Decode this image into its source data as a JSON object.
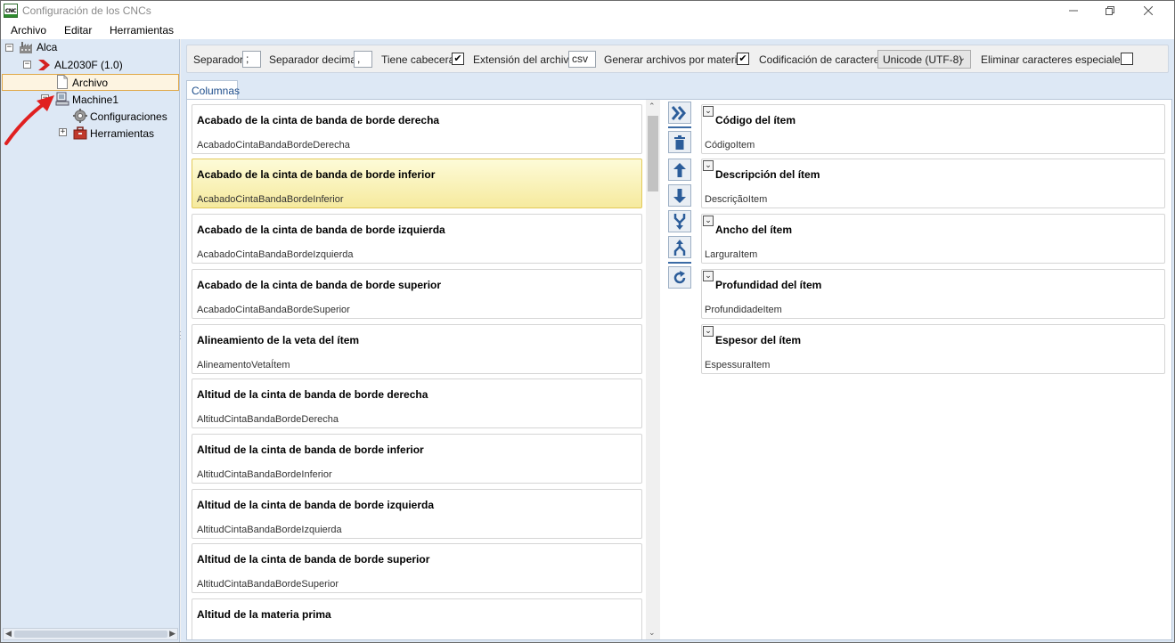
{
  "window": {
    "title": "Configuración de los CNCs",
    "app_icon_text": "CNC"
  },
  "menu": [
    "Archivo",
    "Editar",
    "Herramientas"
  ],
  "tree": {
    "root": {
      "label": "Alca",
      "icon": "factory-icon"
    },
    "machine_group": {
      "label": "AL2030F (1.0)",
      "icon": "chevron-right-red-icon"
    },
    "selected": {
      "label": "Archivo",
      "icon": "document-icon"
    },
    "machine": {
      "label": "Machine1",
      "icon": "computer-icon"
    },
    "config": {
      "label": "Configuraciones",
      "icon": "gear-icon"
    },
    "tools": {
      "label": "Herramientas",
      "icon": "toolbox-icon"
    }
  },
  "options": {
    "separador_label": "Separador",
    "separador_value": ";",
    "decimal_label": "Separador decimal",
    "decimal_value": ",",
    "cabecera_label": "Tiene cabecera",
    "cabecera_checked": true,
    "extension_label": "Extensión del archivo",
    "extension_value": "csv",
    "por_material_label": "Generar archivos por material",
    "por_material_checked": true,
    "codificacion_label": "Codificación de caracteres",
    "codificacion_value": "Unicode (UTF-8)",
    "eliminar_label": "Eliminar caracteres especiales",
    "eliminar_checked": false
  },
  "tabs": [
    "Columnas"
  ],
  "available_columns": [
    {
      "title": "Acabado de la cinta de banda de borde derecha",
      "key": "AcabadoCintaBandaBordeDerecha"
    },
    {
      "title": "Acabado de la cinta de banda de borde inferior",
      "key": "AcabadoCintaBandaBordeInferior"
    },
    {
      "title": "Acabado de la cinta de banda de borde izquierda",
      "key": "AcabadoCintaBandaBordeIzquierda"
    },
    {
      "title": "Acabado de la cinta de banda de borde superior",
      "key": "AcabadoCintaBandaBordeSuperior"
    },
    {
      "title": "Alineamiento de la veta del ítem",
      "key": "AlineamentoVetaÍtem"
    },
    {
      "title": "Altitud de la cinta de banda de borde derecha",
      "key": "AltitudCintaBandaBordeDerecha"
    },
    {
      "title": "Altitud de la cinta de banda de borde inferior",
      "key": "AltitudCintaBandaBordeInferior"
    },
    {
      "title": "Altitud de la cinta de banda de borde izquierda",
      "key": "AltitudCintaBandaBordeIzquierda"
    },
    {
      "title": "Altitud de la cinta de banda de borde superior",
      "key": "AltitudCintaBandaBordeSuperior"
    },
    {
      "title": "Altitud de la materia prima",
      "key": ""
    }
  ],
  "selected_available_index": 1,
  "selected_columns": [
    {
      "title": "Código del ítem",
      "key": "CódigoItem"
    },
    {
      "title": "Descripción del ítem",
      "key": "DescriçãoItem"
    },
    {
      "title": "Ancho del ítem",
      "key": "LarguraItem"
    },
    {
      "title": "Profundidad del ítem",
      "key": "ProfundidadeItem"
    },
    {
      "title": "Espesor del ítem",
      "key": "EspessuraItem"
    }
  ],
  "tool_buttons": [
    "add-columns",
    "delete",
    "move-up",
    "move-down",
    "merge",
    "split",
    "refresh"
  ],
  "colors": {
    "panel_bg": "#dde8f5",
    "accent_blue": "#3b6ba5",
    "selected_yellow": "#f6ea9e",
    "annotation_red": "#e02020"
  }
}
